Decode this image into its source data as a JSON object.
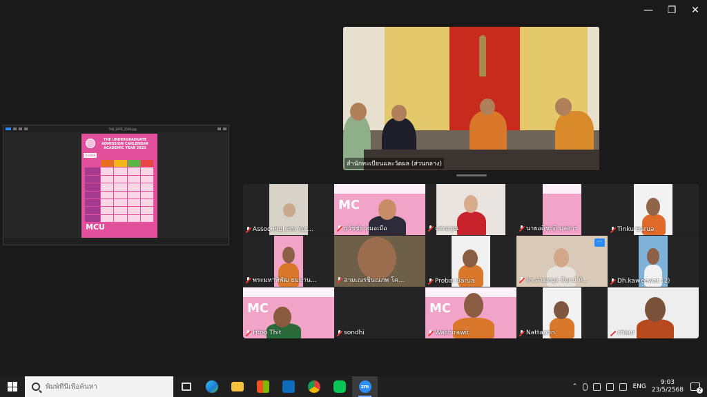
{
  "window": {
    "controls": [
      "—",
      "❐",
      "✕"
    ]
  },
  "shared_screen": {
    "title": "THE_DATE_2568.jpg",
    "poster": {
      "heading": "THE UNDERGRADUATE ADMISSION CARLENDAR ACADEMIC YEAR 2025",
      "badge": "TCAS68",
      "logo": "MCU"
    }
  },
  "speaker": {
    "caption": "สำนักทะเบียนและวัดผล (ส่วนกลาง)"
  },
  "gallery": {
    "participants": [
      {
        "name": "Assoc.Prof.Pm Yut...",
        "muted": true
      },
      {
        "name": "ธวัชชัย  หมอเมือ",
        "muted": true
      },
      {
        "name": "แสงอรุณ",
        "muted": true
      },
      {
        "name": "นายอดิชาติ มลสาร",
        "muted": true
      },
      {
        "name": "Tinku Barua",
        "muted": true
      },
      {
        "name": "พระมหาพิพัฒ ธมมาน...",
        "muted": true
      },
      {
        "name": "สามเณรชินณภพ โค...",
        "muted": true
      },
      {
        "name": "Probal Barua",
        "muted": true
      },
      {
        "name": "ดร.สามทบุล มีฤกษ์ ห้...",
        "muted": true
      },
      {
        "name": "Dh.kaweewat (2)",
        "muted": true
      },
      {
        "name": "Htoo Thit",
        "muted": true
      },
      {
        "name": "sondhi",
        "muted": true
      },
      {
        "name": "Wachirawit",
        "muted": true
      },
      {
        "name": "Nattapon",
        "muted": true
      },
      {
        "name": "chaur",
        "muted": true
      }
    ],
    "more_button": "···"
  },
  "taskbar": {
    "search_placeholder": "พิมพ์ที่นี่เพื่อค้นหา",
    "zoom_label": "zm",
    "input_lang": "ENG",
    "time": "9:03",
    "date": "23/5/2568",
    "notification_count": "2"
  }
}
